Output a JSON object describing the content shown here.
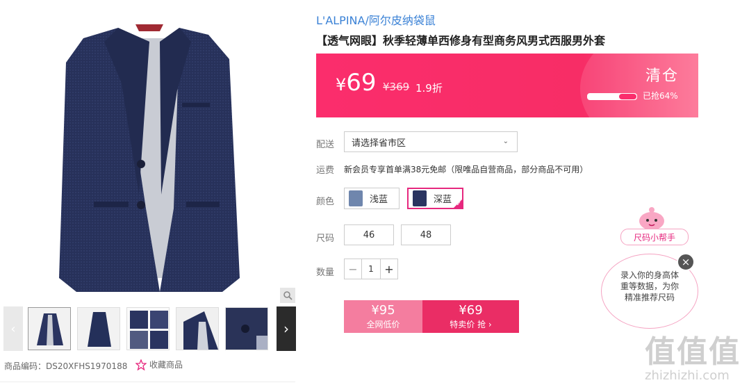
{
  "brand": "L'ALPINA/阿尔皮纳袋鼠",
  "title": "【透气网眼】秋季轻薄单西修身有型商务风男式西服男外套",
  "price": {
    "currency": "¥",
    "current": "69",
    "original": "¥369",
    "discount": "1.9折",
    "tag": "清仓",
    "sold_label": "已抢64%",
    "sold_fraction": 0.64
  },
  "delivery": {
    "label": "配送",
    "placeholder": "请选择省市区"
  },
  "shipping": {
    "label": "运费",
    "text": "新会员专享首单满38元免邮（限唯品自营商品，部分商品不可用）"
  },
  "color": {
    "label": "颜色",
    "options": [
      {
        "name": "浅蓝"
      },
      {
        "name": "深蓝",
        "selected": true
      }
    ]
  },
  "size": {
    "label": "尺码",
    "options": [
      "46",
      "48"
    ]
  },
  "quantity": {
    "label": "数量",
    "minus": "−",
    "value": "1",
    "plus": "+"
  },
  "buttons": {
    "all_net": {
      "price": "¥95",
      "label": "全网低价"
    },
    "special": {
      "price": "¥69",
      "label": "特卖价 抢 ›"
    }
  },
  "product_code": "商品编码：DS20XFHS1970188",
  "favorite": "收藏商品",
  "helper": {
    "label": "尺码小帮手",
    "bubble": "录入你的身高体重等数据，为你精准推荐尺码",
    "close": "×"
  },
  "watermark": {
    "logo": "值值值",
    "url": "zhizhizhi.com"
  },
  "colors": {
    "accent": "#fb2d6c",
    "brand_link": "#3b82d6",
    "selected_border": "#e6287e"
  }
}
